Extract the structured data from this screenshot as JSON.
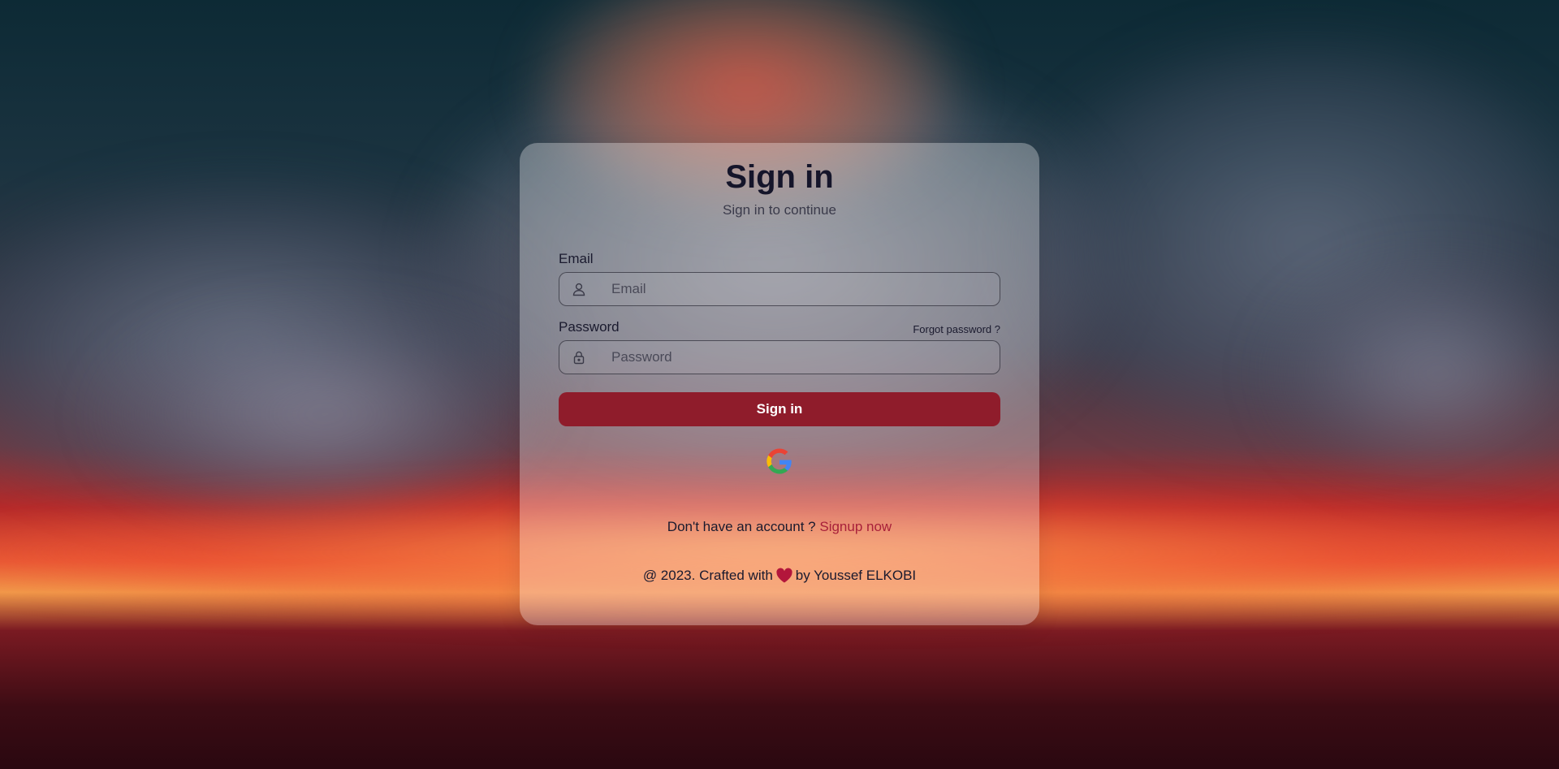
{
  "signin": {
    "title": "Sign in",
    "subtitle": "Sign in to continue",
    "email": {
      "label": "Email",
      "placeholder": "Email",
      "value": ""
    },
    "password": {
      "label": "Password",
      "placeholder": "Password",
      "value": "",
      "forgot_label": "Forgot password ?"
    },
    "submit_label": "Sign in",
    "signup_prompt": "Don't have an account ?",
    "signup_link": "Signup now",
    "footer_prefix": "@ 2023. Crafted with",
    "footer_suffix": "by Youssef ELKOBI"
  },
  "colors": {
    "accent": "#8f1c2b",
    "link": "#a8203a",
    "heart": "#b3163b"
  },
  "icons": {
    "email": "user-icon",
    "password": "lock-icon",
    "social": "google-icon",
    "footer": "heart-icon"
  }
}
